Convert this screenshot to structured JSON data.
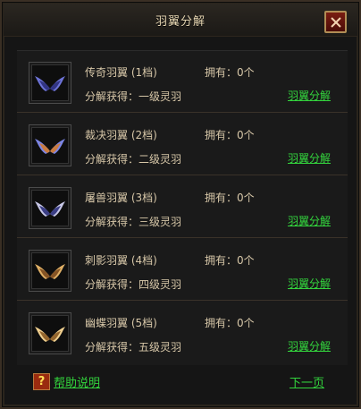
{
  "window": {
    "title": "羽翼分解"
  },
  "items": [
    {
      "name": "传奇羽翼 (1档)",
      "owned": "拥有：0个",
      "gain": "分解获得：一级灵羽",
      "action": "羽翼分解",
      "icon": "wing-icon",
      "color_main": "#6e74d8",
      "color_accent": "#2b2f7a"
    },
    {
      "name": "裁决羽翼 (2档)",
      "owned": "拥有：0个",
      "gain": "分解获得：二级灵羽",
      "action": "羽翼分解",
      "icon": "wing-icon",
      "color_main": "#7c86e6",
      "color_accent": "#d27a2e"
    },
    {
      "name": "屠兽羽翼 (3档)",
      "owned": "拥有：0个",
      "gain": "分解获得：三级灵羽",
      "action": "羽翼分解",
      "icon": "wing-icon",
      "color_main": "#c7c7e6",
      "color_accent": "#2b2f7a"
    },
    {
      "name": "刺影羽翼 (4档)",
      "owned": "拥有：0个",
      "gain": "分解获得：四级灵羽",
      "action": "羽翼分解",
      "icon": "wing-icon",
      "color_main": "#e0b066",
      "color_accent": "#7b4a1e"
    },
    {
      "name": "幽蝶羽翼 (5档)",
      "owned": "拥有：0个",
      "gain": "分解获得：五级灵羽",
      "action": "羽翼分解",
      "icon": "wing-icon",
      "color_main": "#f0d090",
      "color_accent": "#8a5a24"
    }
  ],
  "footer": {
    "help_icon": "?",
    "help_label": "帮助说明",
    "next_label": "下一页"
  },
  "colors": {
    "link": "#33d43d",
    "text": "#d7c7a8",
    "title": "#e7d7b3"
  }
}
